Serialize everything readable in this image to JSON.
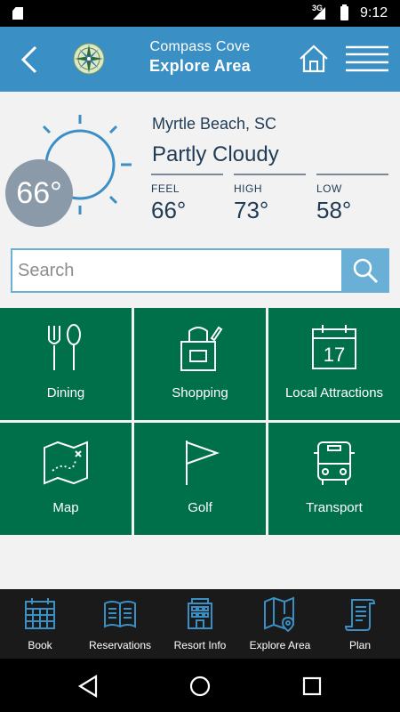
{
  "status_bar": {
    "network": "3G",
    "time": "9:12"
  },
  "header": {
    "subtitle": "Compass Cove",
    "title": "Explore Area"
  },
  "weather": {
    "temperature": "66°",
    "location": "Myrtle Beach, SC",
    "condition": "Partly Cloudy",
    "stats": [
      {
        "label": "FEEL",
        "value": "66°"
      },
      {
        "label": "HIGH",
        "value": "73°"
      },
      {
        "label": "LOW",
        "value": "58°"
      }
    ]
  },
  "search": {
    "placeholder": "Search"
  },
  "tiles": [
    {
      "label": "Dining",
      "icon": "fork-spoon-icon"
    },
    {
      "label": "Shopping",
      "icon": "shopping-bag-icon"
    },
    {
      "label": "Local Attractions",
      "icon": "calendar-icon",
      "calendar_day": "17"
    },
    {
      "label": "Map",
      "icon": "map-icon"
    },
    {
      "label": "Golf",
      "icon": "golf-flag-icon"
    },
    {
      "label": "Transport",
      "icon": "bus-icon"
    }
  ],
  "bottom_nav": [
    {
      "label": "Book",
      "icon": "calendar-grid-icon"
    },
    {
      "label": "Reservations",
      "icon": "book-icon"
    },
    {
      "label": "Resort Info",
      "icon": "building-icon"
    },
    {
      "label": "Explore Area",
      "icon": "map-pin-icon"
    },
    {
      "label": "Plan",
      "icon": "scroll-icon"
    }
  ],
  "colors": {
    "header": "#3a8fc4",
    "tile": "#00704a",
    "search_button": "#6ab0d6",
    "nav_icon": "#3a8fc4"
  }
}
